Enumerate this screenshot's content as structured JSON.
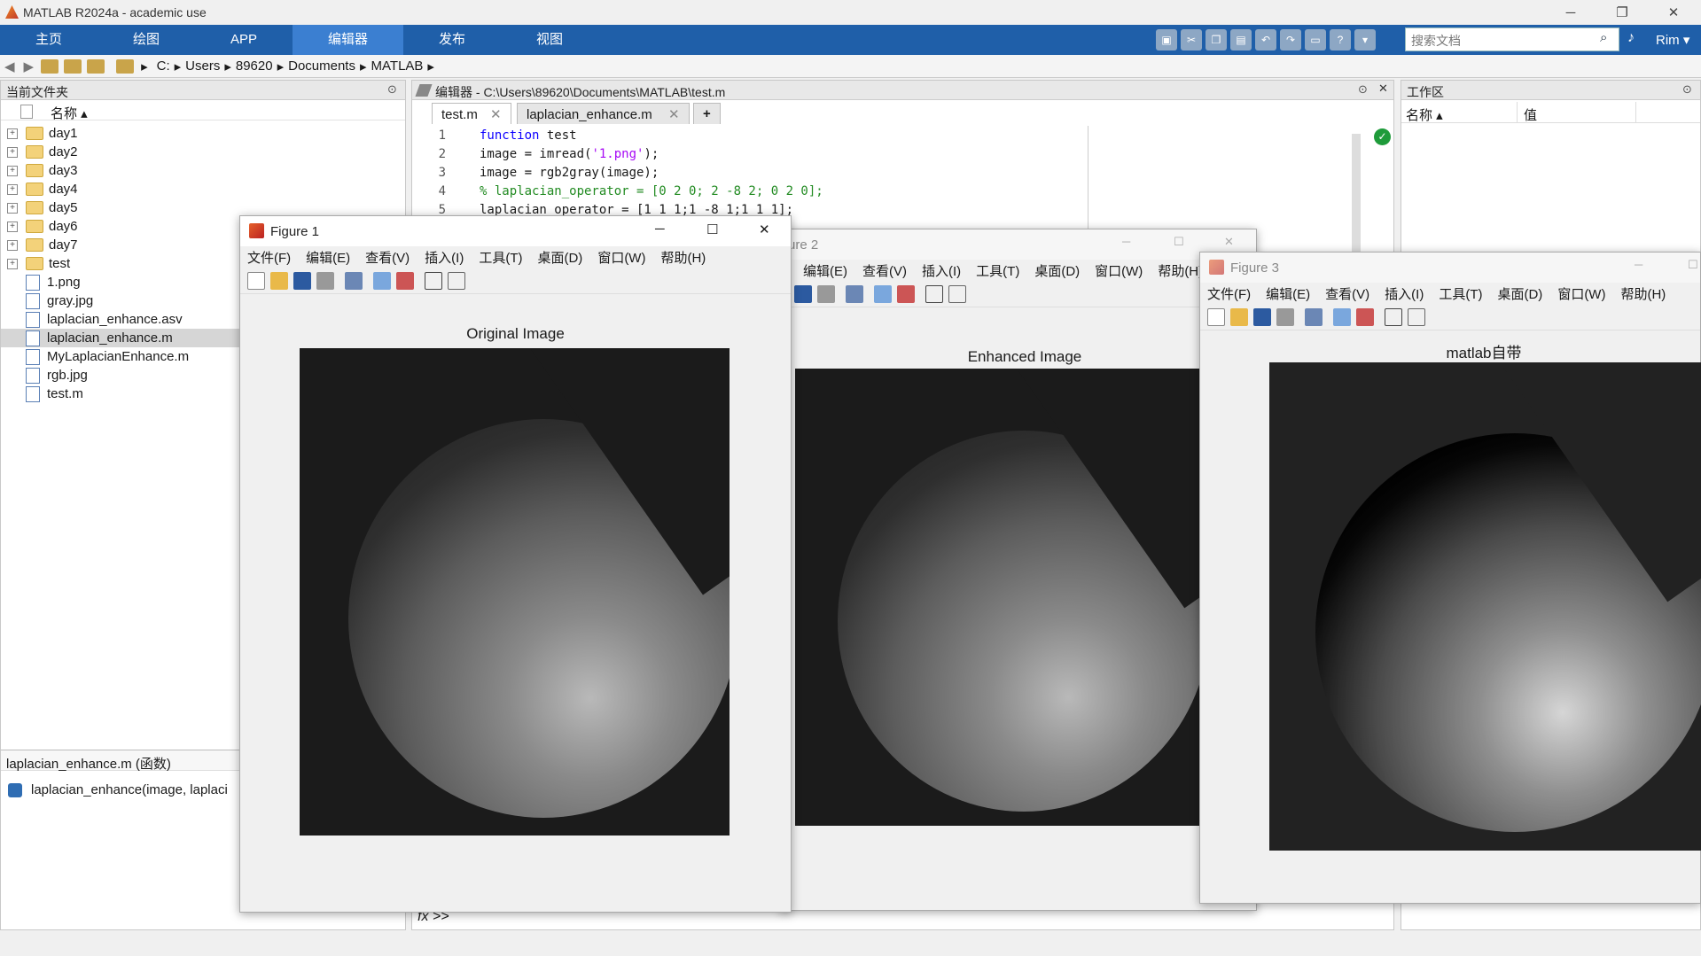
{
  "window": {
    "title": "MATLAB R2024a - academic use",
    "minimize": "─",
    "maximize": "❐",
    "close": "✕"
  },
  "ribbon": {
    "tabs": [
      "主页",
      "绘图",
      "APP",
      "编辑器",
      "发布",
      "视图"
    ],
    "search_placeholder": "搜索文档",
    "user": "Rim ▾",
    "accent": "#1f5fa9"
  },
  "path": {
    "segments": [
      "C:",
      "Users",
      "89620",
      "Documents",
      "MATLAB"
    ]
  },
  "current_folder": {
    "title": "当前文件夹",
    "col_name": "名称 ▴",
    "folders": [
      "day1",
      "day2",
      "day3",
      "day4",
      "day5",
      "day6",
      "day7",
      "test"
    ],
    "files": [
      "1.png",
      "gray.jpg",
      "laplacian_enhance.asv",
      "laplacian_enhance.m",
      "MyLaplacianEnhance.m",
      "rgb.jpg",
      "test.m"
    ],
    "selected": "laplacian_enhance.m",
    "details_title": "laplacian_enhance.m (函数)",
    "details_sig": "laplacian_enhance(image, laplaci"
  },
  "editor": {
    "title": "编辑器 - C:\\Users\\89620\\Documents\\MATLAB\\test.m",
    "tabs": [
      "test.m",
      "laplacian_enhance.m"
    ],
    "add_tab": "+",
    "lines": [
      {
        "n": "1",
        "text": "function test"
      },
      {
        "n": "2",
        "text": "image = imread('1.png');"
      },
      {
        "n": "3",
        "text": "image = rgb2gray(image);"
      },
      {
        "n": "4",
        "text": "% laplacian_operator = [0 2 0; 2 -8 2; 0 2 0];"
      },
      {
        "n": "5",
        "text": "laplacian_operator = [1 1 1;1 -8 1;1 1 1];"
      }
    ],
    "cmd_prompt": "fx >>"
  },
  "workspace": {
    "title": "工作区",
    "col_name": "名称 ▴",
    "col_value": "值"
  },
  "figures": [
    {
      "title": "Figure 1",
      "menus": [
        "文件(F)",
        "编辑(E)",
        "查看(V)",
        "插入(I)",
        "工具(T)",
        "桌面(D)",
        "窗口(W)",
        "帮助(H)"
      ],
      "axes_title": "Original Image"
    },
    {
      "title": "ure 2",
      "menus": [
        "编辑(E)",
        "查看(V)",
        "插入(I)",
        "工具(T)",
        "桌面(D)",
        "窗口(W)",
        "帮助(H)"
      ],
      "axes_title": "Enhanced Image"
    },
    {
      "title": "Figure 3",
      "menus": [
        "文件(F)",
        "编辑(E)",
        "查看(V)",
        "插入(I)",
        "工具(T)",
        "桌面(D)",
        "窗口(W)",
        "帮助(H)"
      ],
      "axes_title": "matlab自带"
    }
  ]
}
